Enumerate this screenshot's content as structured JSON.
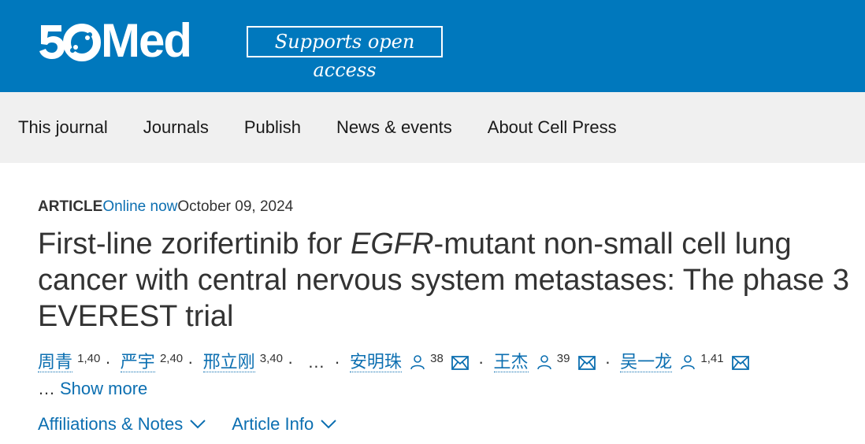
{
  "header": {
    "logo_text": "Med",
    "open_access_label": "Supports open access",
    "colors": {
      "background": "#0078bd",
      "text": "#ffffff"
    }
  },
  "nav": {
    "items": [
      {
        "label": "This journal"
      },
      {
        "label": "Journals"
      },
      {
        "label": "Publish"
      },
      {
        "label": "News & events"
      },
      {
        "label": "About Cell Press"
      }
    ]
  },
  "article": {
    "type": "ARTICLE",
    "status": "Online now",
    "date": "October 09, 2024",
    "title_part1": "First-line zorifertinib for ",
    "title_italic": "EGFR",
    "title_part2": "-mutant non-small cell lung cancer with central nervous system metastases: The phase 3 EVEREST trial",
    "authors": [
      {
        "name": "周青",
        "sup": "1,40"
      },
      {
        "name": "严宇",
        "sup": "2,40"
      },
      {
        "name": "邢立刚",
        "sup": "3,40"
      },
      {
        "name": "安明珠",
        "sup": "38"
      },
      {
        "name": "王杰",
        "sup": "39"
      },
      {
        "name": "吴一龙",
        "sup": "1,41"
      }
    ],
    "ellipsis": "…",
    "show_more_dots": "…",
    "show_more_label": "Show more",
    "affiliations_label": "Affiliations & Notes",
    "article_info_label": "Article Info",
    "link_color": "#0c6fb1"
  }
}
